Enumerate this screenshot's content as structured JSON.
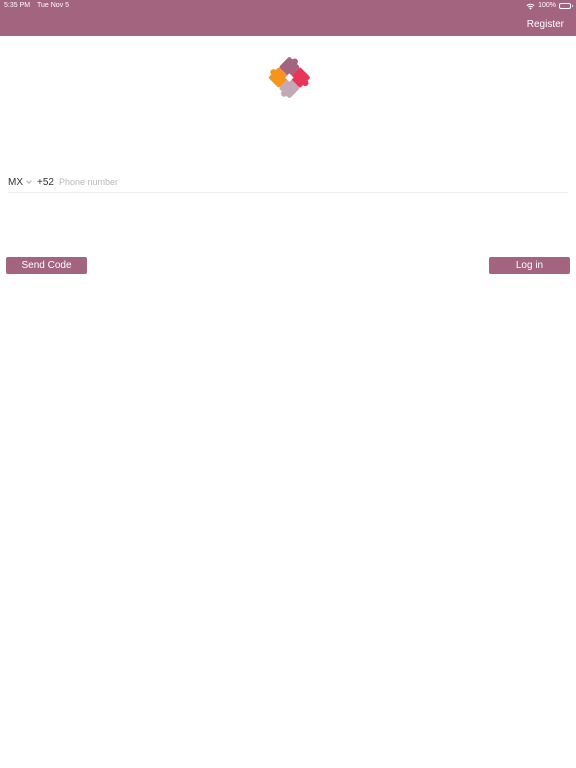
{
  "status_bar": {
    "time": "5:35 PM",
    "date": "Tue Nov 5",
    "battery": "100%",
    "battery_level": 1.0
  },
  "header": {
    "register_label": "Register",
    "background_color": "#a3647f"
  },
  "logo": {
    "icon": "puzzle-hearts-logo",
    "colors": [
      "#a3647f",
      "#e8365a",
      "#f7941d",
      "#c5a8b8"
    ]
  },
  "login_form": {
    "country_code": "MX",
    "dial_code": "+52",
    "phone_placeholder": "Phone number",
    "phone_value": ""
  },
  "buttons": {
    "send_code_label": "Send Code",
    "login_label": "Log in"
  }
}
